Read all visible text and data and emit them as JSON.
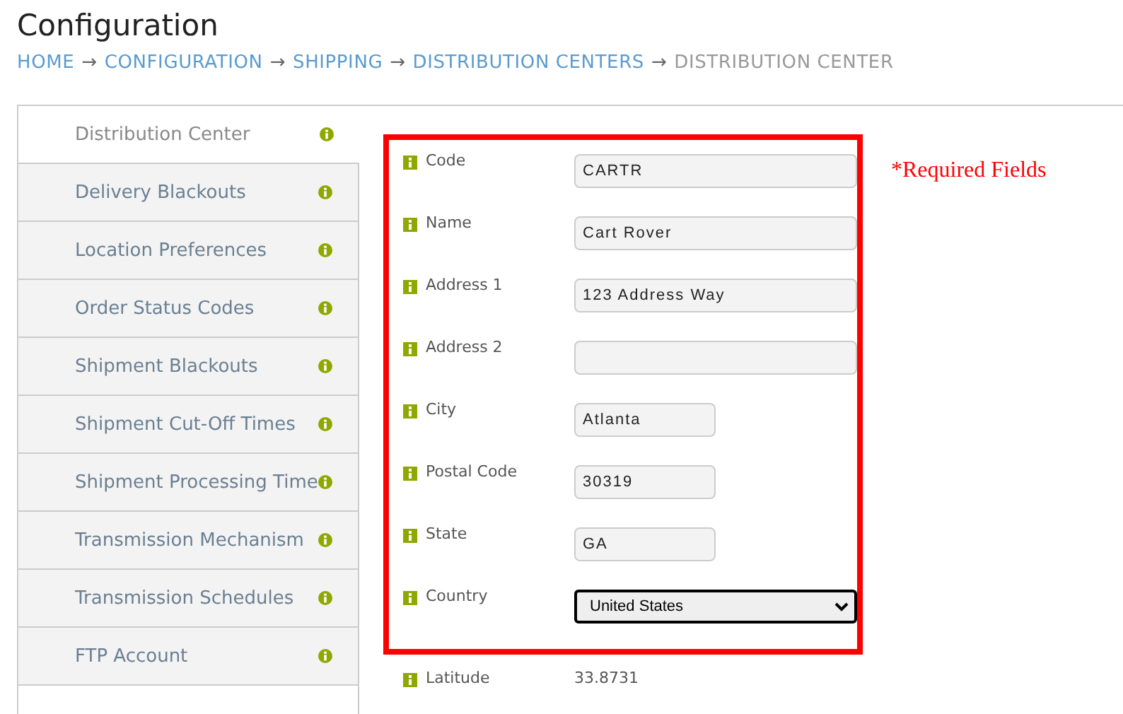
{
  "title": "Configuration",
  "breadcrumb": [
    {
      "label": "HOME",
      "link": true
    },
    {
      "label": "CONFIGURATION",
      "link": true
    },
    {
      "label": "SHIPPING",
      "link": true
    },
    {
      "label": "DISTRIBUTION CENTERS",
      "link": true
    },
    {
      "label": "DISTRIBUTION CENTER",
      "link": false
    }
  ],
  "breadcrumb_separator": "→",
  "sidebar": {
    "items": [
      {
        "label": "Distribution Center",
        "selected": true
      },
      {
        "label": "Delivery Blackouts",
        "selected": false
      },
      {
        "label": "Location Preferences",
        "selected": false
      },
      {
        "label": "Order Status Codes",
        "selected": false
      },
      {
        "label": "Shipment Blackouts",
        "selected": false
      },
      {
        "label": "Shipment Cut-Off Times",
        "selected": false
      },
      {
        "label": "Shipment Processing Time",
        "selected": false
      },
      {
        "label": "Transmission Mechanism",
        "selected": false
      },
      {
        "label": "Transmission Schedules",
        "selected": false
      },
      {
        "label": "FTP Account",
        "selected": false
      }
    ]
  },
  "form": {
    "required_fields": [
      {
        "label": "Code",
        "kind": "text",
        "value": "CARTR"
      },
      {
        "label": "Name",
        "kind": "text",
        "value": "Cart Rover"
      },
      {
        "label": "Address 1",
        "kind": "text",
        "value": "123 Address Way"
      },
      {
        "label": "Address 2",
        "kind": "text"
      },
      {
        "label": "City",
        "kind": "shorttext",
        "value": "Atlanta"
      },
      {
        "label": "Postal Code",
        "kind": "shorttext",
        "value": "30319"
      },
      {
        "label": "State",
        "kind": "shorttext",
        "value": "GA"
      },
      {
        "label": "Country",
        "kind": "select",
        "value": "United States"
      }
    ],
    "other_fields": [
      {
        "label": "Latitude",
        "kind": "static",
        "value": "33.8731"
      }
    ],
    "required_note": "*Required Fields"
  }
}
